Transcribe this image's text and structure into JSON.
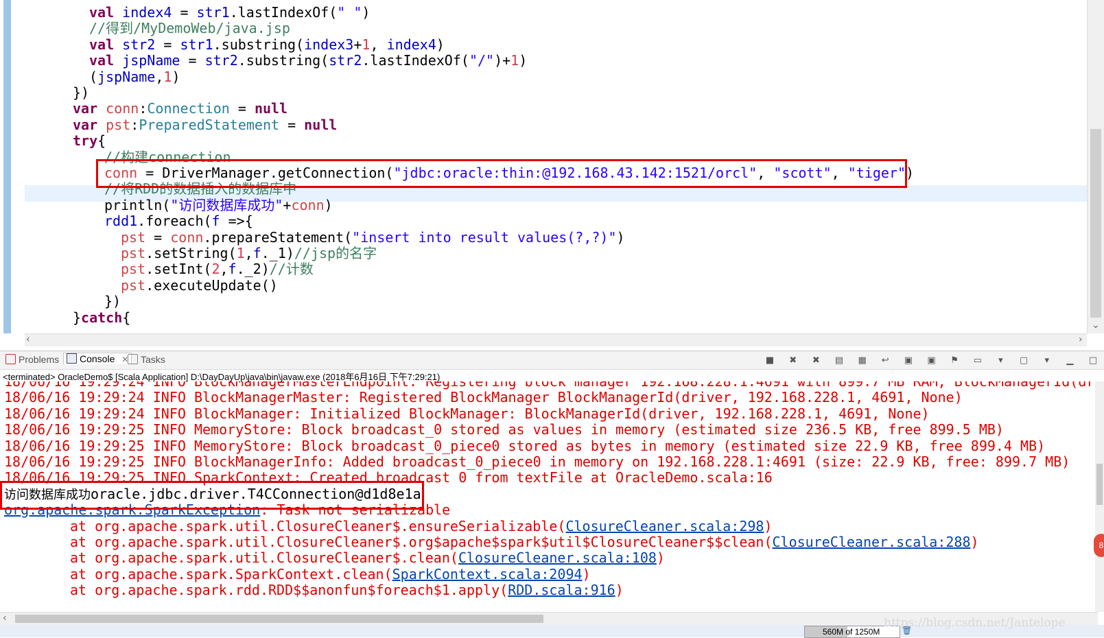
{
  "editor": {
    "lines": [
      {
        "segments": [
          [
            "kw",
            "val"
          ],
          [
            "",
            ""
          ],
          [
            "var",
            "index4"
          ],
          [
            "",
            " = "
          ],
          [
            "var",
            "str1"
          ],
          [
            "",
            ".lastIndexOf("
          ],
          [
            "str",
            "\" \""
          ],
          [
            "",
            ")"
          ]
        ],
        "indent": "    "
      },
      {
        "segments": [
          [
            "cmt",
            "//得到/MyDemoWeb/java.jsp"
          ]
        ],
        "indent": "    "
      },
      {
        "segments": [
          [
            "kw",
            "val"
          ],
          [
            "",
            " "
          ],
          [
            "var",
            "str2"
          ],
          [
            "",
            " = "
          ],
          [
            "var",
            "str1"
          ],
          [
            "",
            ".substring("
          ],
          [
            "var",
            "index3"
          ],
          [
            "",
            "+"
          ],
          [
            "num",
            "1"
          ],
          [
            "",
            ", "
          ],
          [
            "var",
            "index4"
          ],
          [
            "",
            ")"
          ]
        ],
        "indent": "    "
      },
      {
        "segments": [
          [
            "kw",
            "val"
          ],
          [
            "",
            " "
          ],
          [
            "var",
            "jspName"
          ],
          [
            "",
            " = "
          ],
          [
            "var",
            "str2"
          ],
          [
            "",
            ".substring("
          ],
          [
            "var",
            "str2"
          ],
          [
            "",
            ".lastIndexOf("
          ],
          [
            "str",
            "\"/\""
          ],
          [
            "",
            ")+"
          ],
          [
            "num",
            "1"
          ],
          [
            "",
            ")"
          ]
        ],
        "indent": "    "
      },
      {
        "segments": [
          [
            "",
            "("
          ],
          [
            "var",
            "jspName"
          ],
          [
            "",
            ","
          ],
          [
            "num",
            "1"
          ],
          [
            "",
            ")"
          ]
        ],
        "indent": "    "
      },
      {
        "segments": [
          [
            "",
            "})"
          ]
        ],
        "indent": "  "
      },
      {
        "segments": [
          [
            "kw",
            "var"
          ],
          [
            "",
            " "
          ],
          [
            "fld",
            "conn"
          ],
          [
            "",
            ":"
          ],
          [
            "type",
            "Connection"
          ],
          [
            "",
            " = "
          ],
          [
            "kw",
            "null"
          ]
        ],
        "indent": "  "
      },
      {
        "segments": [
          [
            "kw",
            "var"
          ],
          [
            "",
            " "
          ],
          [
            "fld",
            "pst"
          ],
          [
            "",
            ":"
          ],
          [
            "type",
            "PreparedStatement"
          ],
          [
            "",
            " = "
          ],
          [
            "kw",
            "null"
          ]
        ],
        "indent": "  "
      },
      {
        "segments": [
          [
            "kw",
            "try"
          ],
          [
            "",
            "{"
          ]
        ],
        "indent": "  "
      },
      {
        "segments": [
          [
            "cmt",
            "//构建connection"
          ]
        ],
        "indent": "    "
      },
      {
        "segments": [
          [
            "fld",
            "conn"
          ],
          [
            "",
            " = DriverManager.getConnection("
          ],
          [
            "str",
            "\"jdbc:oracle:thin:@192.168.43.142:1521/orcl\""
          ],
          [
            "",
            ", "
          ],
          [
            "str",
            "\"scott\""
          ],
          [
            "",
            ", "
          ],
          [
            "str",
            "\"tiger\""
          ],
          [
            "",
            ")"
          ]
        ],
        "indent": "    "
      },
      {
        "segments": [
          [
            "cmt",
            "//将RDD的数据插入的数据库中"
          ]
        ],
        "indent": "    "
      },
      {
        "segments": [
          [
            "",
            "println("
          ],
          [
            "str",
            "\"访问数据库成功\""
          ],
          [
            "",
            "+"
          ],
          [
            "fld",
            "conn"
          ],
          [
            "",
            ")"
          ]
        ],
        "indent": "    "
      },
      {
        "segments": [
          [
            "var",
            "rdd1"
          ],
          [
            "",
            ".foreach("
          ],
          [
            "var",
            "f"
          ],
          [
            "",
            " =>{"
          ]
        ],
        "indent": "    "
      },
      {
        "segments": [
          [
            "fld",
            "pst"
          ],
          [
            "",
            " = "
          ],
          [
            "fld",
            "conn"
          ],
          [
            "",
            ".prepareStatement("
          ],
          [
            "str",
            "\"insert into result values(?,?)\""
          ],
          [
            "",
            ")"
          ]
        ],
        "indent": "      "
      },
      {
        "segments": [
          [
            "fld",
            "pst"
          ],
          [
            "",
            ".setString("
          ],
          [
            "num",
            "1"
          ],
          [
            "",
            ","
          ],
          [
            "var",
            "f"
          ],
          [
            "",
            "._1)"
          ],
          [
            "cmt",
            "//jsp的名字"
          ]
        ],
        "indent": "      "
      },
      {
        "segments": [
          [
            "fld",
            "pst"
          ],
          [
            "",
            ".setInt("
          ],
          [
            "num",
            "2"
          ],
          [
            "",
            ","
          ],
          [
            "var",
            "f"
          ],
          [
            "",
            "._2)"
          ],
          [
            "cmt",
            "//计数"
          ]
        ],
        "indent": "      "
      },
      {
        "segments": [
          [
            "fld",
            "pst"
          ],
          [
            "",
            ".executeUpdate()"
          ]
        ],
        "indent": "      "
      },
      {
        "segments": [
          [
            "",
            "})"
          ]
        ],
        "indent": "    "
      },
      {
        "segments": [
          [
            "",
            "}"
          ],
          [
            "kw",
            "catch"
          ],
          [
            "",
            "{"
          ]
        ],
        "indent": "  "
      }
    ]
  },
  "panel": {
    "tabs": [
      {
        "label": "Problems"
      },
      {
        "label": "Console",
        "close": "✕"
      },
      {
        "label": "Tasks"
      }
    ],
    "status": "<terminated> OracleDemo$ [Scala Application] D:\\DayDayUp\\java\\bin\\javaw.exe (2018年6月16日 下午7:29:21)"
  },
  "console": {
    "lines": [
      {
        "type": "err",
        "text": "18/06/16 19:29:24 INFO BlockManagerMasterEndpoint: Registering block manager 192.168.228.1:4691 with 899.7 MB RAM, BlockManagerId(dri"
      },
      {
        "type": "err",
        "text": "18/06/16 19:29:24 INFO BlockManagerMaster: Registered BlockManager BlockManagerId(driver, 192.168.228.1, 4691, None)"
      },
      {
        "type": "err",
        "text": "18/06/16 19:29:24 INFO BlockManager: Initialized BlockManager: BlockManagerId(driver, 192.168.228.1, 4691, None)"
      },
      {
        "type": "err",
        "text": "18/06/16 19:29:25 INFO MemoryStore: Block broadcast_0 stored as values in memory (estimated size 236.5 KB, free 899.5 MB)"
      },
      {
        "type": "err",
        "text": "18/06/16 19:29:25 INFO MemoryStore: Block broadcast_0_piece0 stored as bytes in memory (estimated size 22.9 KB, free 899.4 MB)"
      },
      {
        "type": "err",
        "text": "18/06/16 19:29:25 INFO BlockManagerInfo: Added broadcast_0_piece0 in memory on 192.168.228.1:4691 (size: 22.9 KB, free: 899.7 MB)"
      },
      {
        "type": "err",
        "text": "18/06/16 19:29:25 INFO SparkContext: Created broadcast 0 from textFile at OracleDemo.scala:16"
      },
      {
        "type": "out",
        "prefix": "访问数据库成功",
        "text": "oracle.jdbc.driver.T4CConnection@d1d8e1a"
      },
      {
        "type": "exc",
        "link": "org.apache.spark.SparkException",
        "text": ": Task not serializable"
      },
      {
        "type": "at",
        "text": "at org.apache.spark.util.ClosureCleaner$.ensureSerializable(",
        "link": "ClosureCleaner.scala:298",
        "tail": ")"
      },
      {
        "type": "at",
        "text": "at org.apache.spark.util.ClosureCleaner$.org$apache$spark$util$ClosureCleaner$$clean(",
        "link": "ClosureCleaner.scala:288",
        "tail": ")"
      },
      {
        "type": "at",
        "text": "at org.apache.spark.util.ClosureCleaner$.clean(",
        "link": "ClosureCleaner.scala:108",
        "tail": ")"
      },
      {
        "type": "at",
        "text": "at org.apache.spark.SparkContext.clean(",
        "link": "SparkContext.scala:2094",
        "tail": ")"
      },
      {
        "type": "at",
        "text": "at org.apache.spark.rdd.RDD$$anonfun$foreach$1.apply(",
        "link": "RDD.scala:916",
        "tail": ")"
      }
    ]
  },
  "statusbar": {
    "memory": "560M of 1250M",
    "memory_used_fraction": 0.448,
    "watermark": "https://blog.csdn.net/Jantelope"
  },
  "colors": {
    "highlight_box": "#e00000",
    "error_text": "#e00000",
    "link": "#0645ad"
  }
}
